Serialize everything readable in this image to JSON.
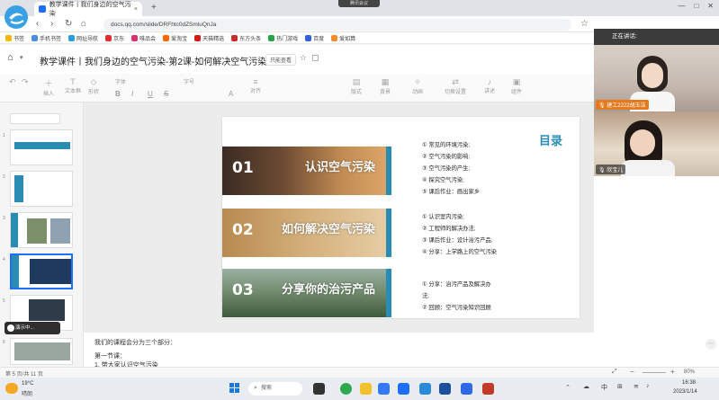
{
  "browser": {
    "tab_title": "教学课件丨我们身边的空气污染",
    "tab_close": "×",
    "new_tab": "+",
    "meeting_pill": "腾讯会议",
    "window_controls": [
      "—",
      "□",
      "✕"
    ],
    "url": "docs.qq.com/slide/DRFhtc0dZSmluQnJa",
    "bookmarks": [
      "书签",
      "手机书签",
      "网址导航",
      "京东",
      "唯品会",
      "爱淘宝",
      "天猫精选",
      "东方头条",
      "热门游戏",
      "百度",
      "爱如算"
    ]
  },
  "doc": {
    "title": "教学课件丨我们身边的空气污染-第2课-如何解决空气污染",
    "uneditable": "只能查看"
  },
  "toolbar": {
    "items": [
      "插入",
      "文本框",
      "形状",
      "字体",
      "字号",
      "B",
      "I",
      "U",
      "S",
      "A",
      "对齐",
      "版式",
      "背景",
      "动画",
      "切换设置",
      "讲述",
      "组件"
    ]
  },
  "sidebar": {
    "slide_numbers": [
      "1",
      "2",
      "3",
      "4",
      "5",
      "6"
    ],
    "speaker_button": "演示中..."
  },
  "slide": {
    "heading": "目录",
    "sections": [
      {
        "num": "01",
        "title": "认识空气污染",
        "items": [
          "① 常见的环境污染;",
          "② 空气污染的影响;",
          "③ 空气污染的产生;",
          "④ 探究空气污染;",
          "⑤ 课后作业：画出家乡"
        ]
      },
      {
        "num": "02",
        "title": "如何解决空气污染",
        "items": [
          "① 认识室内污染;",
          "② 工程师的解决办法;",
          "③ 课后作业：设计治污产品;",
          "④ 分享：上学路上的空气污染"
        ]
      },
      {
        "num": "03",
        "title": "分享你的治污产品",
        "items": [
          "① 分享：治污产品及解决办",
          "法;",
          "② 回顾：空气污染知识回顾"
        ]
      }
    ]
  },
  "notes": {
    "line1": "我们的课程会分为三个部分：",
    "line2": "第一节课：",
    "line3": "1. 带大家认识空气污染"
  },
  "status": {
    "page": "第 5 页/共 11 页",
    "zoom": "80%",
    "zoom_minus": "−",
    "zoom_plus": "+"
  },
  "taskbar": {
    "weather_temp": "19°C",
    "weather_text": "晴朗",
    "search": "搜索",
    "ime": "中",
    "time": "16:38",
    "date": "2023/1/14"
  },
  "video_panel": {
    "speaking": "正在讲话:",
    "participant_1": "建工2222胡玉洁",
    "participant_2": "欣宝儿"
  }
}
